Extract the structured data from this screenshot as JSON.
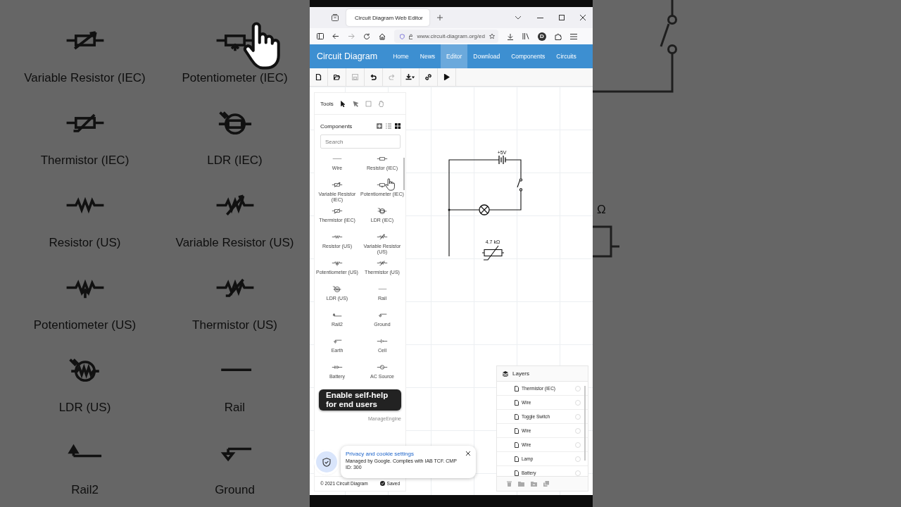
{
  "left_background": {
    "components": [
      {
        "name": "Variable Resistor (IEC)",
        "kind": "variable-resistor-iec"
      },
      {
        "name": "Potentiometer (IEC)",
        "kind": "potentiometer-iec"
      },
      {
        "name": "Thermistor (IEC)",
        "kind": "thermistor-iec"
      },
      {
        "name": "LDR (IEC)",
        "kind": "ldr-iec"
      },
      {
        "name": "Resistor (US)",
        "kind": "resistor-us"
      },
      {
        "name": "Variable Resistor (US)",
        "kind": "variable-resistor-us"
      },
      {
        "name": "Potentiometer (US)",
        "kind": "potentiometer-us"
      },
      {
        "name": "Thermistor (US)",
        "kind": "thermistor-us"
      },
      {
        "name": "LDR (US)",
        "kind": "ldr-us"
      },
      {
        "name": "Rail",
        "kind": "rail"
      },
      {
        "name": "Rail2",
        "kind": "rail2"
      },
      {
        "name": "Ground",
        "kind": "ground"
      }
    ]
  },
  "right_background": {
    "label_fragment": "Ω"
  },
  "browser": {
    "tab_title": "Circuit Diagram Web Editor",
    "url": "www.circuit-diagram.org/ed",
    "profile_initial": "D"
  },
  "site_nav": {
    "brand": "Circuit Diagram",
    "links": [
      {
        "label": "Home",
        "selected": false
      },
      {
        "label": "News",
        "selected": false
      },
      {
        "label": "Editor",
        "selected": true
      },
      {
        "label": "Download",
        "selected": false
      },
      {
        "label": "Components",
        "selected": false
      },
      {
        "label": "Circuits",
        "selected": false
      }
    ]
  },
  "toolbar": [
    {
      "kind": "new",
      "disabled": false
    },
    {
      "kind": "open",
      "disabled": false
    },
    {
      "kind": "save",
      "disabled": true
    },
    {
      "kind": "undo",
      "disabled": false
    },
    {
      "kind": "redo",
      "disabled": true
    },
    {
      "kind": "download",
      "disabled": false
    },
    {
      "kind": "link",
      "disabled": false
    },
    {
      "kind": "run",
      "disabled": false
    }
  ],
  "tools_panel": {
    "title": "Tools",
    "tools": [
      {
        "kind": "pointer",
        "selected": true
      },
      {
        "kind": "direct-select",
        "selected": false
      },
      {
        "kind": "rectangle",
        "selected": false
      },
      {
        "kind": "hand",
        "selected": false
      }
    ]
  },
  "components_panel": {
    "title": "Components",
    "view_modes": [
      {
        "kind": "add",
        "selected": false
      },
      {
        "kind": "list",
        "selected": false
      },
      {
        "kind": "grid",
        "selected": true
      }
    ],
    "search": {
      "placeholder": "Search"
    },
    "items": [
      {
        "name": "Wire",
        "kind": "wire"
      },
      {
        "name": "Resistor (IEC)",
        "kind": "resistor-iec"
      },
      {
        "name": "Variable Resistor (IEC)",
        "kind": "variable-resistor-iec"
      },
      {
        "name": "Potentiometer (IEC)",
        "kind": "potentiometer-iec"
      },
      {
        "name": "Thermistor (IEC)",
        "kind": "thermistor-iec"
      },
      {
        "name": "LDR (IEC)",
        "kind": "ldr-iec"
      },
      {
        "name": "Resistor (US)",
        "kind": "resistor-us"
      },
      {
        "name": "Variable Resistor (US)",
        "kind": "variable-resistor-us"
      },
      {
        "name": "Potentiometer (US)",
        "kind": "potentiometer-us"
      },
      {
        "name": "Thermistor (US)",
        "kind": "thermistor-us"
      },
      {
        "name": "LDR (US)",
        "kind": "ldr-us"
      },
      {
        "name": "Rail",
        "kind": "rail"
      },
      {
        "name": "Rail2",
        "kind": "rail2"
      },
      {
        "name": "Ground",
        "kind": "ground"
      },
      {
        "name": "Earth",
        "kind": "earth"
      },
      {
        "name": "Cell",
        "kind": "cell"
      },
      {
        "name": "Battery",
        "kind": "battery"
      },
      {
        "name": "AC Source",
        "kind": "ac-source"
      }
    ]
  },
  "ad": {
    "headline": "Enable self-help for end users",
    "sponsor": "ManageEngine"
  },
  "footer": {
    "copyright": "© 2021 Circuit Diagram",
    "status": "Saved"
  },
  "canvas": {
    "battery_label": "+5V",
    "thermistor_label": "4.7 kΩ"
  },
  "layers": {
    "title": "Layers",
    "items": [
      {
        "name": "Thermistor (IEC)",
        "selected": false
      },
      {
        "name": "Wire",
        "selected": false
      },
      {
        "name": "Toggle Switch",
        "selected": false
      },
      {
        "name": "Wire",
        "selected": false
      },
      {
        "name": "Wire",
        "selected": false
      },
      {
        "name": "Lamp",
        "selected": false
      },
      {
        "name": "Battery",
        "selected": false
      }
    ]
  },
  "cookie_notice": {
    "title": "Privacy and cookie settings",
    "text": "Managed by Google. Complies with IAB TCF. CMP ID: 300"
  }
}
